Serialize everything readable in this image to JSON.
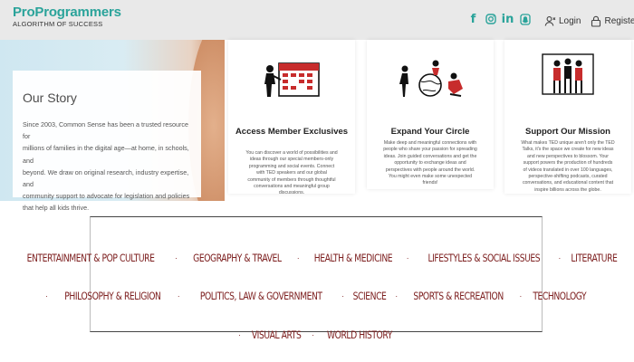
{
  "brand": {
    "name": "ProProgrammers",
    "tagline": "ALGORITHM OF SUCCESS"
  },
  "social": [
    "facebook-icon",
    "instagram-icon",
    "linkedin-icon",
    "snapchat-icon"
  ],
  "auth": {
    "login": "Login",
    "register": "Register"
  },
  "colors": {
    "brand": "#2aa39a",
    "topic_text": "#7c1e1e",
    "header_bg": "#e9e9e9"
  },
  "hero": {
    "title": "Our Story",
    "lines": [
      "Since 2003, Common Sense has been a trusted resource for",
      "millions of families in the digital age—at home, in schools, and",
      "beyond. We draw on original research, industry expertise, and",
      "community support to advocate for legislation and policies",
      "that help all kids thrive."
    ]
  },
  "cards": [
    {
      "title": "Access Member Exclusives",
      "body": "You can discover a world of possibilities and ideas through our special members-only programming and social events. Connect with TED speakers and our global community of members through thoughtful conversations and meaningful group discussions."
    },
    {
      "title": "Expand Your Circle",
      "body": "Make deep and meaningful connections with people who share your passion for spreading ideas. Join guided conversations and get the opportunity to exchange ideas and perspectives with people around the world. You might even make some unexpected friends!"
    },
    {
      "title": "Support Our Mission",
      "body": "What makes TED unique aren't only the TED Talks, it's the space we create for new ideas and new perspectives to blossom. Your support powers the production of hundreds of videos translated in over 100 languages, perspective-shifting podcasts, curated conversations, and educational content that inspire billions across the globe."
    }
  ],
  "topics": {
    "row1": [
      "ENTERTAINMENT & POP CULTURE",
      "GEOGRAPHY & TRAVEL",
      "HEALTH & MEDICINE",
      "LIFESTYLES & SOCIAL ISSUES",
      "LITERATURE"
    ],
    "row2": [
      "PHILOSOPHY & RELIGION",
      "POLITICS, LAW & GOVERNMENT",
      "SCIENCE",
      "SPORTS & RECREATION",
      "TECHNOLOGY"
    ],
    "row3": [
      "VISUAL ARTS",
      "WORLD HISTORY"
    ]
  }
}
